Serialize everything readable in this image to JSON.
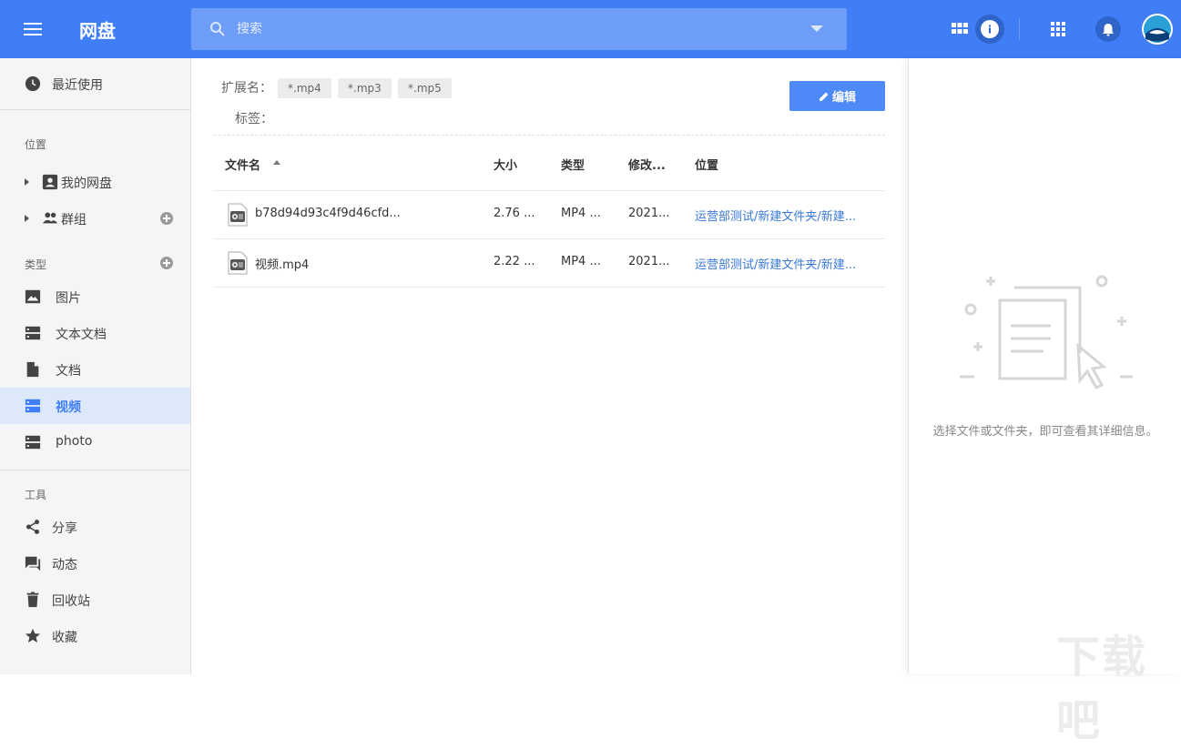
{
  "app": {
    "title": "网盘"
  },
  "search": {
    "placeholder": "搜索"
  },
  "sidebar": {
    "recent": "最近使用",
    "sections": {
      "location": "位置",
      "type": "类型",
      "tools": "工具"
    },
    "locations": [
      {
        "label": "我的网盘"
      },
      {
        "label": "群组"
      }
    ],
    "types": [
      {
        "label": "图片"
      },
      {
        "label": "文本文档"
      },
      {
        "label": "文档"
      },
      {
        "label": "视频",
        "active": true
      },
      {
        "label": "photo"
      }
    ],
    "tools": [
      {
        "label": "分享"
      },
      {
        "label": "动态"
      },
      {
        "label": "回收站"
      },
      {
        "label": "收藏"
      }
    ]
  },
  "filter": {
    "ext_label": "扩展名：",
    "tag_label": "标签：",
    "extensions": [
      "*.mp4",
      "*.mp3",
      "*.mp5"
    ],
    "edit_label": "编辑"
  },
  "table": {
    "columns": {
      "name": "文件名",
      "size": "大小",
      "type": "类型",
      "modified": "修改...",
      "location": "位置"
    },
    "rows": [
      {
        "name": "b78d94d93c4f9d46cfd...",
        "size": "2.76 ...",
        "type": "MP4 ...",
        "modified": "2021...",
        "location": "运营部测试/新建文件夹/新建..."
      },
      {
        "name": "视频.mp4",
        "size": "2.22 ...",
        "type": "MP4 ...",
        "modified": "2021...",
        "location": "运营部测试/新建文件夹/新建..."
      }
    ]
  },
  "detail": {
    "empty_text": "选择文件或文件夹，即可查看其详细信息。"
  },
  "watermark": {
    "text": "下载吧"
  },
  "colors": {
    "primary": "#3f7ef6",
    "link": "#3a78d4",
    "active_bg": "#dde8fb"
  }
}
